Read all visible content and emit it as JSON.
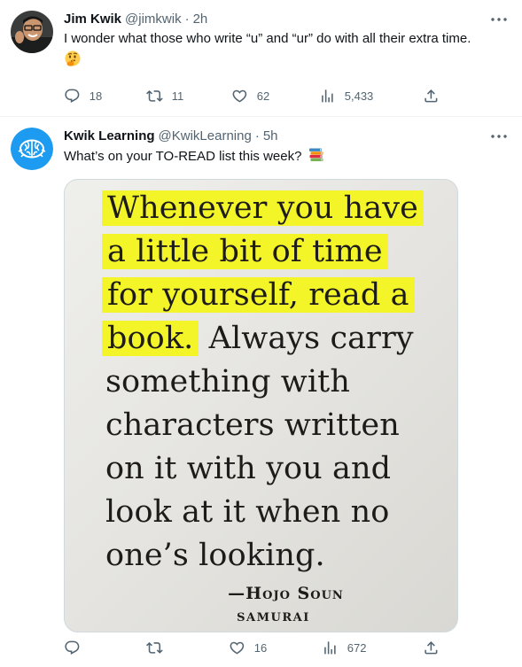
{
  "tweets": [
    {
      "author_name": "Jim Kwik",
      "handle": "@jimkwik",
      "separator": "·",
      "time": "2h",
      "text": "I wonder what those who write “u” and “ur” do with all their extra time.",
      "emoji": "thinking-face",
      "actions": {
        "replies": "18",
        "retweets": "11",
        "likes": "62",
        "views": "5,433"
      }
    },
    {
      "author_name": "Kwik Learning",
      "handle": "@KwikLearning",
      "separator": "·",
      "time": "5h",
      "text": "What’s on your TO-READ list this week?",
      "emoji": "books",
      "image": {
        "quote_lines": [
          "Whenever you have",
          "a little bit of time",
          "for yourself, read a",
          "book.",
          " Always carry",
          "something with",
          "characters written",
          "on it with you and",
          "look at it when no",
          "one’s looking."
        ],
        "author": "—Hojo Soun",
        "book": "SAMURAI",
        "highlight_color": "#f3f528"
      },
      "actions": {
        "replies": "",
        "retweets": "",
        "likes": "16",
        "views": "672"
      }
    }
  ],
  "colors": {
    "text_primary": "#0f1419",
    "text_secondary": "#536471",
    "divider": "#eff3f4",
    "brand_blue": "#1d9bf0"
  }
}
